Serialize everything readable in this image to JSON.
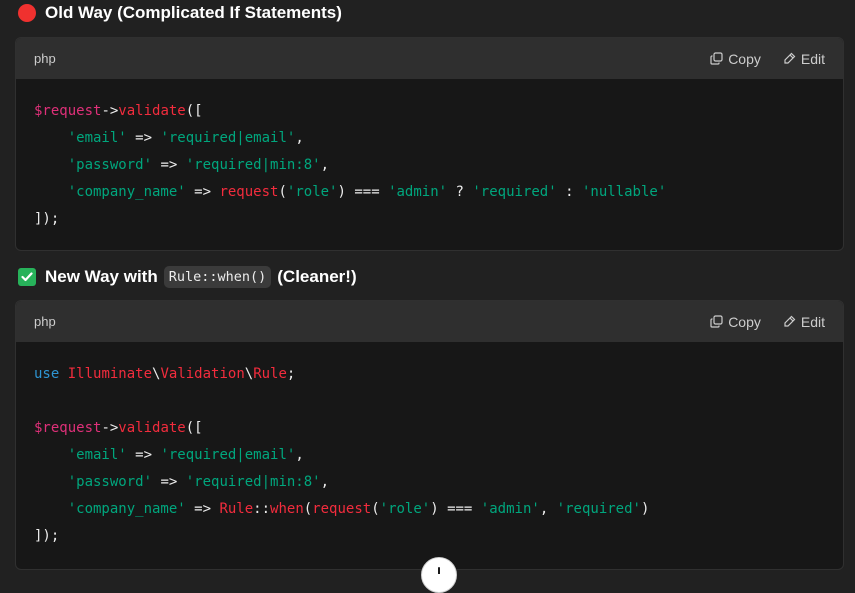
{
  "section_old": {
    "title": "Old Way (Complicated If Statements)",
    "icon": "red-circle-icon",
    "icon_color": "#f0312f"
  },
  "section_new": {
    "title_before": "New Way with",
    "inline_code": "Rule::when()",
    "title_after": "(Cleaner!)",
    "icon": "check-mark-button-icon",
    "icon_color": "#27b25a"
  },
  "code_block_1": {
    "language": "php",
    "copy_label": "Copy",
    "edit_label": "Edit",
    "lines": [
      "$request->validate([",
      "    'email' => 'required|email',",
      "    'password' => 'required|min:8',",
      "    'company_name' => request('role') === 'admin' ? 'required' : 'nullable'",
      "]);"
    ]
  },
  "code_block_2": {
    "language": "php",
    "copy_label": "Copy",
    "edit_label": "Edit",
    "lines": [
      "use Illuminate\\Validation\\Rule;",
      "",
      "$request->validate([",
      "    'email' => 'required|email',",
      "    'password' => 'required|min:8',",
      "    'company_name' => Rule::when(request('role') === 'admin', 'required')",
      "]);"
    ]
  },
  "colors": {
    "background": "#212121",
    "code_background": "#171717",
    "header_background": "#2f2f2f",
    "variable": "#df3079",
    "function": "#f22c3d",
    "string": "#00a67d",
    "keyword": "#2e95d3"
  },
  "scroll_button": {
    "icon": "arrow-down-icon"
  }
}
